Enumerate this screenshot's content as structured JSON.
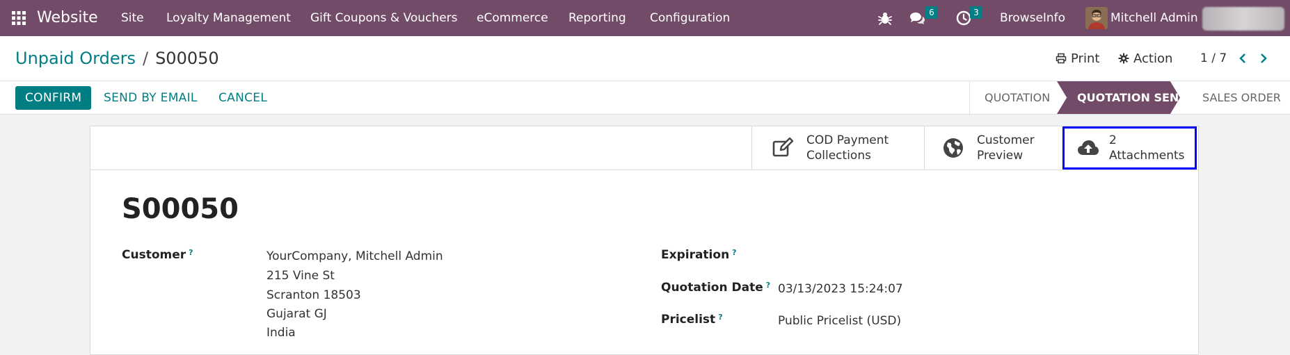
{
  "navbar": {
    "app_name": "Website",
    "menu": [
      "Site",
      "Loyalty Management",
      "Gift Coupons & Vouchers",
      "eCommerce",
      "Reporting",
      "Configuration"
    ],
    "messages_count": "6",
    "activities_count": "3",
    "company": "BrowseInfo",
    "user": "Mitchell Admin",
    "bg_color": "#714b67"
  },
  "breadcrumb": {
    "parent": "Unpaid Orders",
    "separator": "/",
    "current": "S00050"
  },
  "actions": {
    "print": "Print",
    "action": "Action"
  },
  "pager": {
    "value": "1 / 7"
  },
  "statusbar": {
    "confirm": "CONFIRM",
    "send_by_email": "SEND BY EMAIL",
    "cancel": "CANCEL",
    "stages": [
      "QUOTATION",
      "QUOTATION SENT",
      "SALES ORDER"
    ],
    "active_stage": "QUOTATION SENT"
  },
  "smart_buttons": {
    "cod": {
      "line1": "COD Payment",
      "line2": "Collections",
      "icon": "edit-icon"
    },
    "preview": {
      "line1": "Customer",
      "line2": "Preview",
      "icon": "globe-icon"
    },
    "attachments": {
      "count": "2",
      "label": "Attachments",
      "icon": "cloud-upload-icon"
    }
  },
  "record": {
    "name": "S00050",
    "customer_label": "Customer",
    "customer_address": [
      "YourCompany, Mitchell Admin",
      "215 Vine St",
      "Scranton 18503",
      "Gujarat GJ",
      "India"
    ],
    "expiration_label": "Expiration",
    "quotation_date_label": "Quotation Date",
    "quotation_date": "03/13/2023 15:24:07",
    "pricelist_label": "Pricelist",
    "pricelist": "Public Pricelist (USD)",
    "help_marker": "?"
  },
  "colors": {
    "accent": "#017e84",
    "brand": "#714b67",
    "highlight_outline": "#0000ff"
  }
}
